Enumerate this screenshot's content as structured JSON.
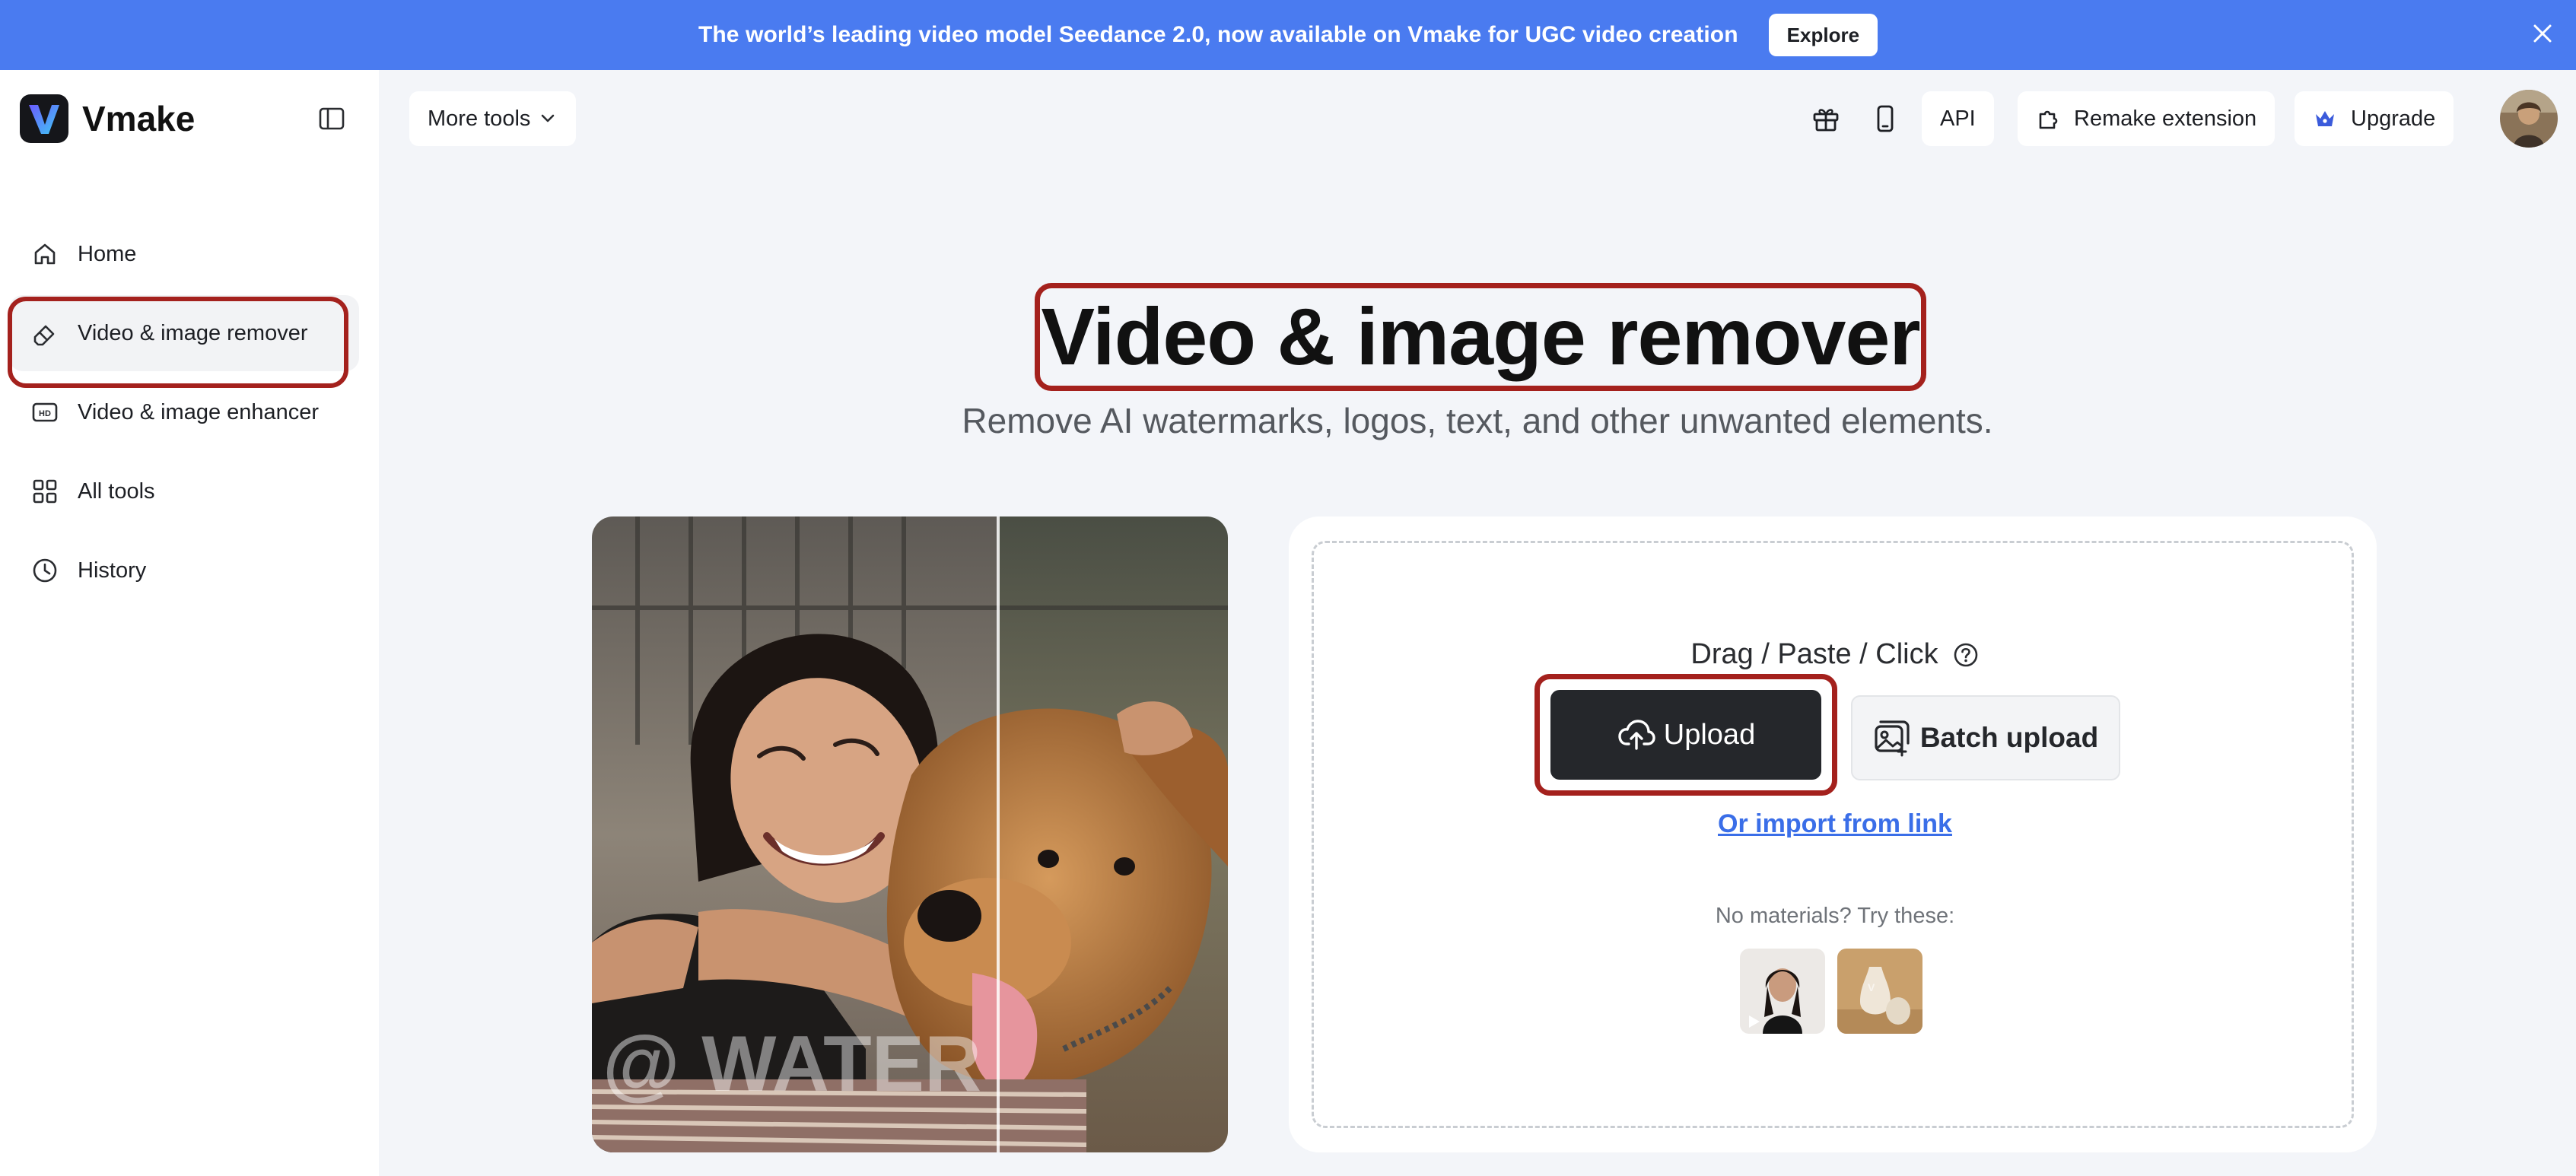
{
  "banner": {
    "text": "The world’s leading video model Seedance 2.0, now available on Vmake for UGC video creation",
    "button": "Explore"
  },
  "brand": {
    "name": "Vmake"
  },
  "sidebar": {
    "items": [
      {
        "label": "Home",
        "icon": "home-icon"
      },
      {
        "label": "Video & image remover",
        "icon": "eraser-icon",
        "active": true
      },
      {
        "label": "Video & image enhancer",
        "icon": "hd-icon"
      },
      {
        "label": "All tools",
        "icon": "grid-icon"
      },
      {
        "label": "History",
        "icon": "clock-icon"
      }
    ]
  },
  "topbar": {
    "more_tools": "More tools",
    "api": "API",
    "remake_extension": "Remake extension",
    "upgrade": "Upgrade"
  },
  "hero": {
    "title": "Video & image remover",
    "subtitle": "Remove AI watermarks, logos, text, and other unwanted elements."
  },
  "preview": {
    "watermark_text": "@ WATER"
  },
  "upload": {
    "hint": "Drag / Paste / Click",
    "upload_label": "Upload",
    "batch_label": "Batch upload",
    "import_link": "Or import from link",
    "no_materials": "No materials? Try these:"
  },
  "colors": {
    "banner": "#4a7bf0",
    "highlight": "#a4211d",
    "link": "#3a6ee8",
    "dark_button": "#25272b"
  }
}
